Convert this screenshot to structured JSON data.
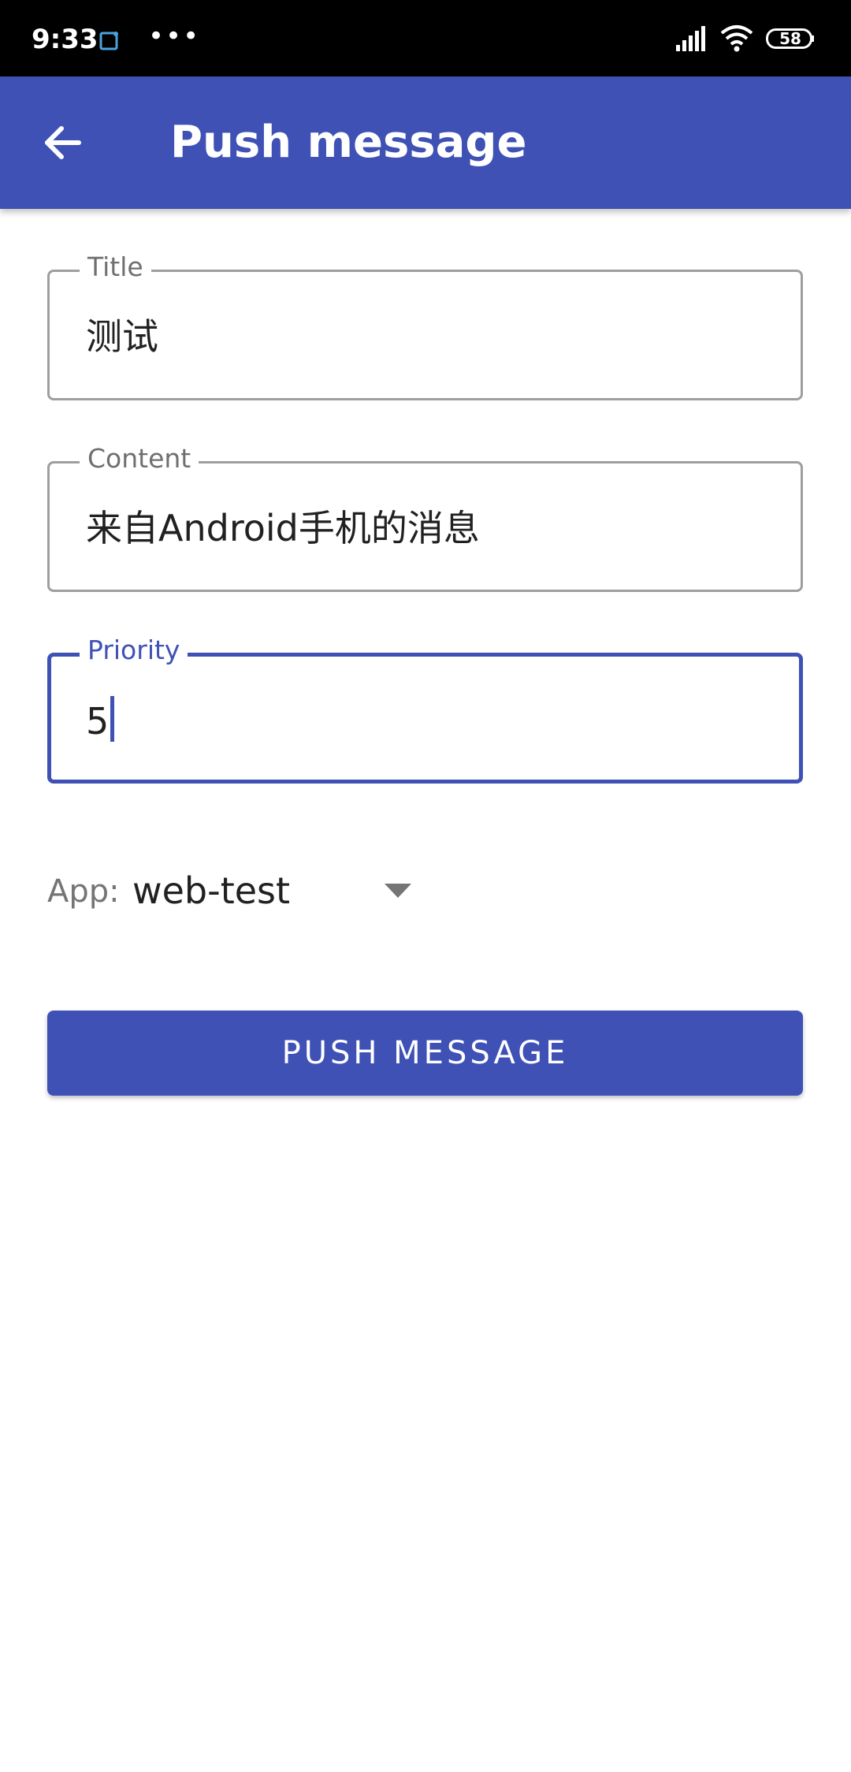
{
  "status_bar": {
    "time": "9:33",
    "more": "•••",
    "battery": "58"
  },
  "app_bar": {
    "title": "Push message"
  },
  "form": {
    "title": {
      "label": "Title",
      "value": "测试"
    },
    "content": {
      "label": "Content",
      "value": "来自Android手机的消息"
    },
    "priority": {
      "label": "Priority",
      "value": "5"
    },
    "app": {
      "label": "App:",
      "selected": "web-test"
    },
    "submit_label": "PUSH MESSAGE"
  },
  "colors": {
    "primary": "#3f51b5",
    "outline": "#9e9e9e",
    "status_bar": "#000000"
  }
}
